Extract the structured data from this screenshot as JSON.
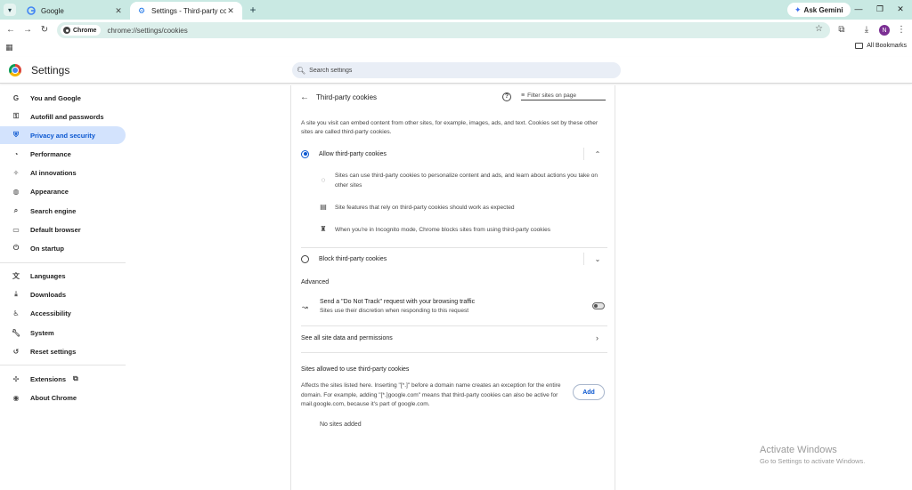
{
  "browser": {
    "tabs": [
      {
        "title": "Google",
        "active": false
      },
      {
        "title": "Settings - Third-party cookies",
        "active": true
      }
    ],
    "ask_gemini": "Ask Gemini",
    "chip_label": "Chrome",
    "url": "chrome://settings/cookies",
    "all_bookmarks": "All Bookmarks",
    "avatar_initial": "N"
  },
  "settings": {
    "title": "Settings",
    "search_placeholder": "Search settings"
  },
  "sidebar": {
    "items": [
      {
        "label": "You and Google",
        "icon": "google-g-icon"
      },
      {
        "label": "Autofill and passwords",
        "icon": "key-icon"
      },
      {
        "label": "Privacy and security",
        "icon": "shield-icon",
        "active": true
      },
      {
        "label": "Performance",
        "icon": "speedometer-icon"
      },
      {
        "label": "AI innovations",
        "icon": "sparkle-icon"
      },
      {
        "label": "Appearance",
        "icon": "palette-icon"
      },
      {
        "label": "Search engine",
        "icon": "search-icon"
      },
      {
        "label": "Default browser",
        "icon": "browser-window-icon"
      },
      {
        "label": "On startup",
        "icon": "power-icon"
      },
      {
        "label": "Languages",
        "icon": "translate-icon"
      },
      {
        "label": "Downloads",
        "icon": "download-icon"
      },
      {
        "label": "Accessibility",
        "icon": "accessibility-icon"
      },
      {
        "label": "System",
        "icon": "wrench-icon"
      },
      {
        "label": "Reset settings",
        "icon": "reset-icon"
      },
      {
        "label": "Extensions",
        "icon": "puzzle-icon"
      },
      {
        "label": "About Chrome",
        "icon": "chrome-logo-icon"
      }
    ]
  },
  "cookies": {
    "page_title": "Third-party cookies",
    "filter_placeholder": "Filter sites on page",
    "description": "A site you visit can embed content from other sites, for example, images, ads, and text. Cookies set by these other sites are called third-party cookies.",
    "allow_label": "Allow third-party cookies",
    "allow_details": [
      {
        "icon": "cookie-icon",
        "text": "Sites can use third-party cookies to personalize content and ads, and learn about actions you take on other sites"
      },
      {
        "icon": "web-page-icon",
        "text": "Site features that rely on third-party cookies should work as expected"
      },
      {
        "icon": "incognito-icon",
        "text": "When you're in Incognito mode, Chrome blocks sites from using third-party cookies"
      }
    ],
    "block_label": "Block third-party cookies",
    "advanced_heading": "Advanced",
    "dnt_title": "Send a \"Do Not Track\" request with your browsing traffic",
    "dnt_subtitle": "Sites use their discretion when responding to this request",
    "see_all_label": "See all site data and permissions",
    "allowed_heading": "Sites allowed to use third-party cookies",
    "allowed_desc": "Affects the sites listed here. Inserting \"[*.]\" before a domain name creates an exception for the entire domain. For example, adding \"[*.]google.com\" means that third-party cookies can also be active for mail.google.com, because it's part of google.com.",
    "add_label": "Add",
    "no_sites": "No sites added"
  },
  "watermark": {
    "line1": "Activate Windows",
    "line2": "Go to Settings to activate Windows."
  },
  "colors": {
    "tab_strip": "#c9e9e3",
    "accent": "#0b57d0",
    "active_nav_bg": "#d3e3fd"
  }
}
